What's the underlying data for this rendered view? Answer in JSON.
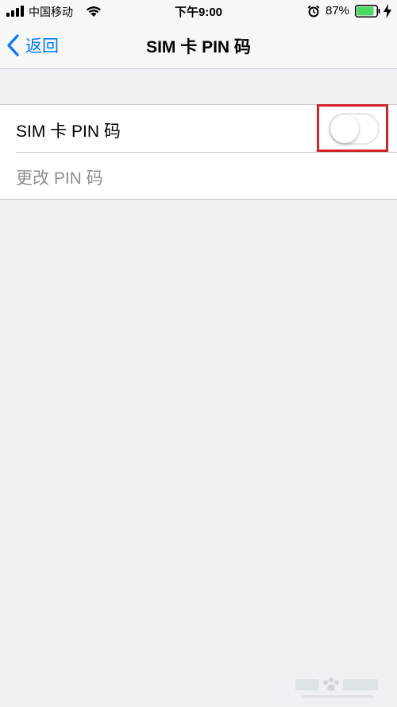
{
  "status_bar": {
    "carrier": "中国移动",
    "time": "下午9:00",
    "battery_percent": "87%",
    "battery_level": 0.87,
    "battery_color": "#4cd964"
  },
  "nav": {
    "back_label": "返回",
    "title": "SIM 卡 PIN 码"
  },
  "settings": {
    "sim_pin_label": "SIM 卡 PIN 码",
    "sim_pin_enabled": false,
    "change_pin_label": "更改 PIN 码",
    "change_pin_enabled": false
  },
  "colors": {
    "accent": "#007aff",
    "highlight": "#d2232a",
    "background": "#efeff4"
  }
}
